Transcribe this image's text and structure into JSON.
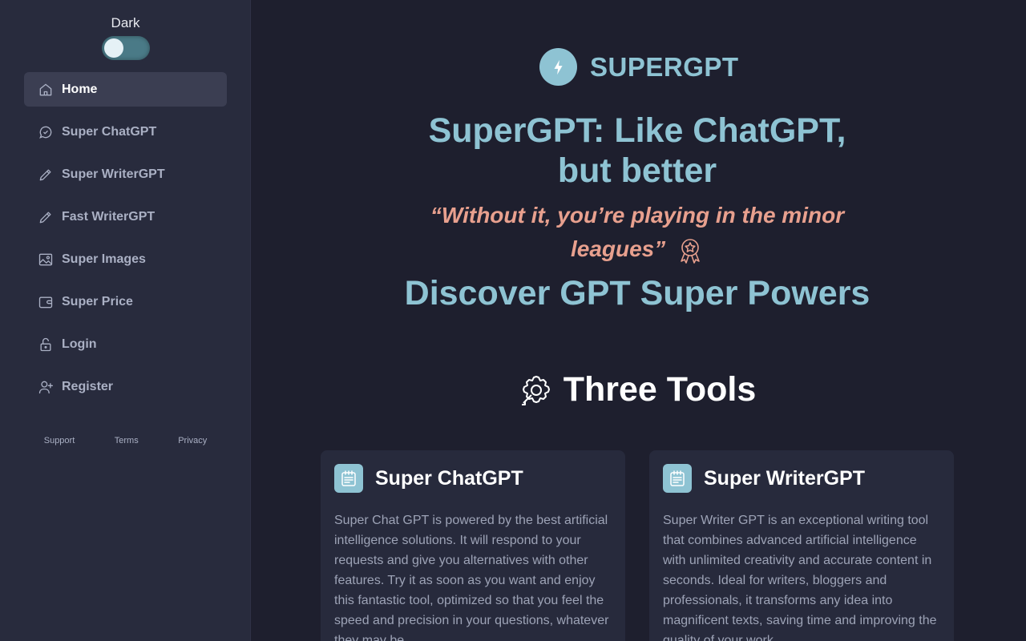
{
  "sidebar": {
    "theme_label": "Dark",
    "nav": [
      {
        "label": "Home",
        "icon": "home-icon",
        "active": true
      },
      {
        "label": "Super ChatGPT",
        "icon": "chat-icon"
      },
      {
        "label": "Super WriterGPT",
        "icon": "pencil-icon"
      },
      {
        "label": "Fast WriterGPT",
        "icon": "pencil-icon"
      },
      {
        "label": "Super Images",
        "icon": "image-icon"
      },
      {
        "label": "Super Price",
        "icon": "wallet-icon"
      },
      {
        "label": "Login",
        "icon": "lock-icon"
      },
      {
        "label": "Register",
        "icon": "user-plus-icon"
      }
    ],
    "footer": {
      "support": "Support",
      "terms": "Terms",
      "privacy": "Privacy"
    }
  },
  "main": {
    "brand": "SUPERGPT",
    "headline_line1": "SuperGPT: Like ChatGPT,",
    "headline_line2": "but better",
    "quote_line1": "“Without it, you’re playing in the minor",
    "quote_line2": "leagues”",
    "discover": "Discover GPT Super Powers",
    "tools_title": "Three Tools",
    "cards": [
      {
        "title": "Super ChatGPT",
        "text": "Super Chat GPT is powered by the best artificial intelligence solutions. It will respond to your requests and give you alternatives with other features. Try it as soon as you want and enjoy this fantastic tool, optimized so that you feel the speed and precision in your questions, whatever they may be."
      },
      {
        "title": "Super WriterGPT",
        "text": "Super Writer GPT is an exceptional writing tool that combines advanced artificial intelligence with unlimited creativity and accurate content in seconds. Ideal for writers, bloggers and professionals, it transforms any idea into magnificent texts, saving time and improving the quality of your work."
      }
    ]
  },
  "colors": {
    "accent": "#8ec3d3",
    "quote": "#e8a08e",
    "sidebar_bg": "#282b3d",
    "main_bg": "#1e1f2e"
  }
}
